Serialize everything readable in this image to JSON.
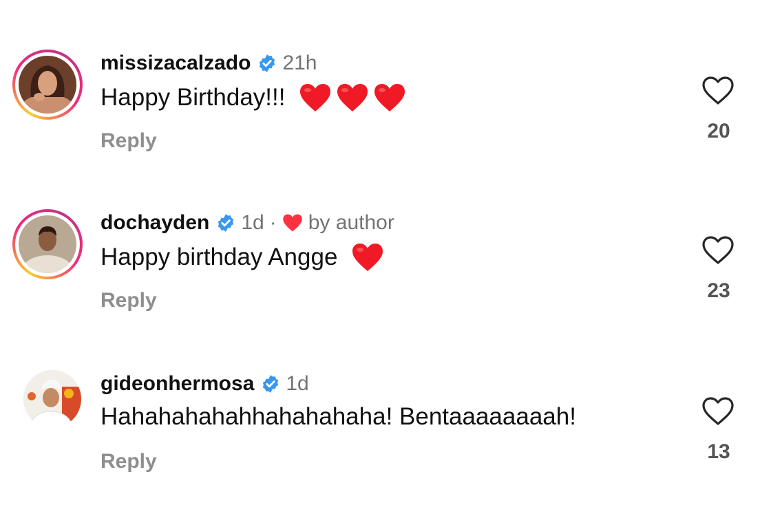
{
  "comments": [
    {
      "username": "missizacalzado",
      "time": "21h",
      "text": "Happy Birthday!!!",
      "reply_label": "Reply",
      "likes": "20",
      "emoji": [
        "heart",
        "heart",
        "heart"
      ],
      "has_story_ring": true
    },
    {
      "username": "dochayden",
      "time": "1d",
      "separator": "·",
      "liked_by": "by author",
      "text": "Happy birthday Angge",
      "reply_label": "Reply",
      "likes": "23",
      "emoji": [
        "heart"
      ],
      "has_story_ring": true
    },
    {
      "username": "gideonhermosa",
      "time": "1d",
      "text": "Hahahahahahhahahahaha! Bentaaaaaaaah!",
      "reply_label": "Reply",
      "likes": "13",
      "emoji": [],
      "has_story_ring": false
    }
  ],
  "colors": {
    "verified": "#3897f0",
    "heart_emoji": "#ef1a25",
    "muted_text": "#737373",
    "reply_text": "#8e8e8e"
  },
  "icons": {
    "verified": "verified-badge-icon",
    "like": "heart-outline-icon",
    "liked_by_author": "heart-filled-icon"
  }
}
